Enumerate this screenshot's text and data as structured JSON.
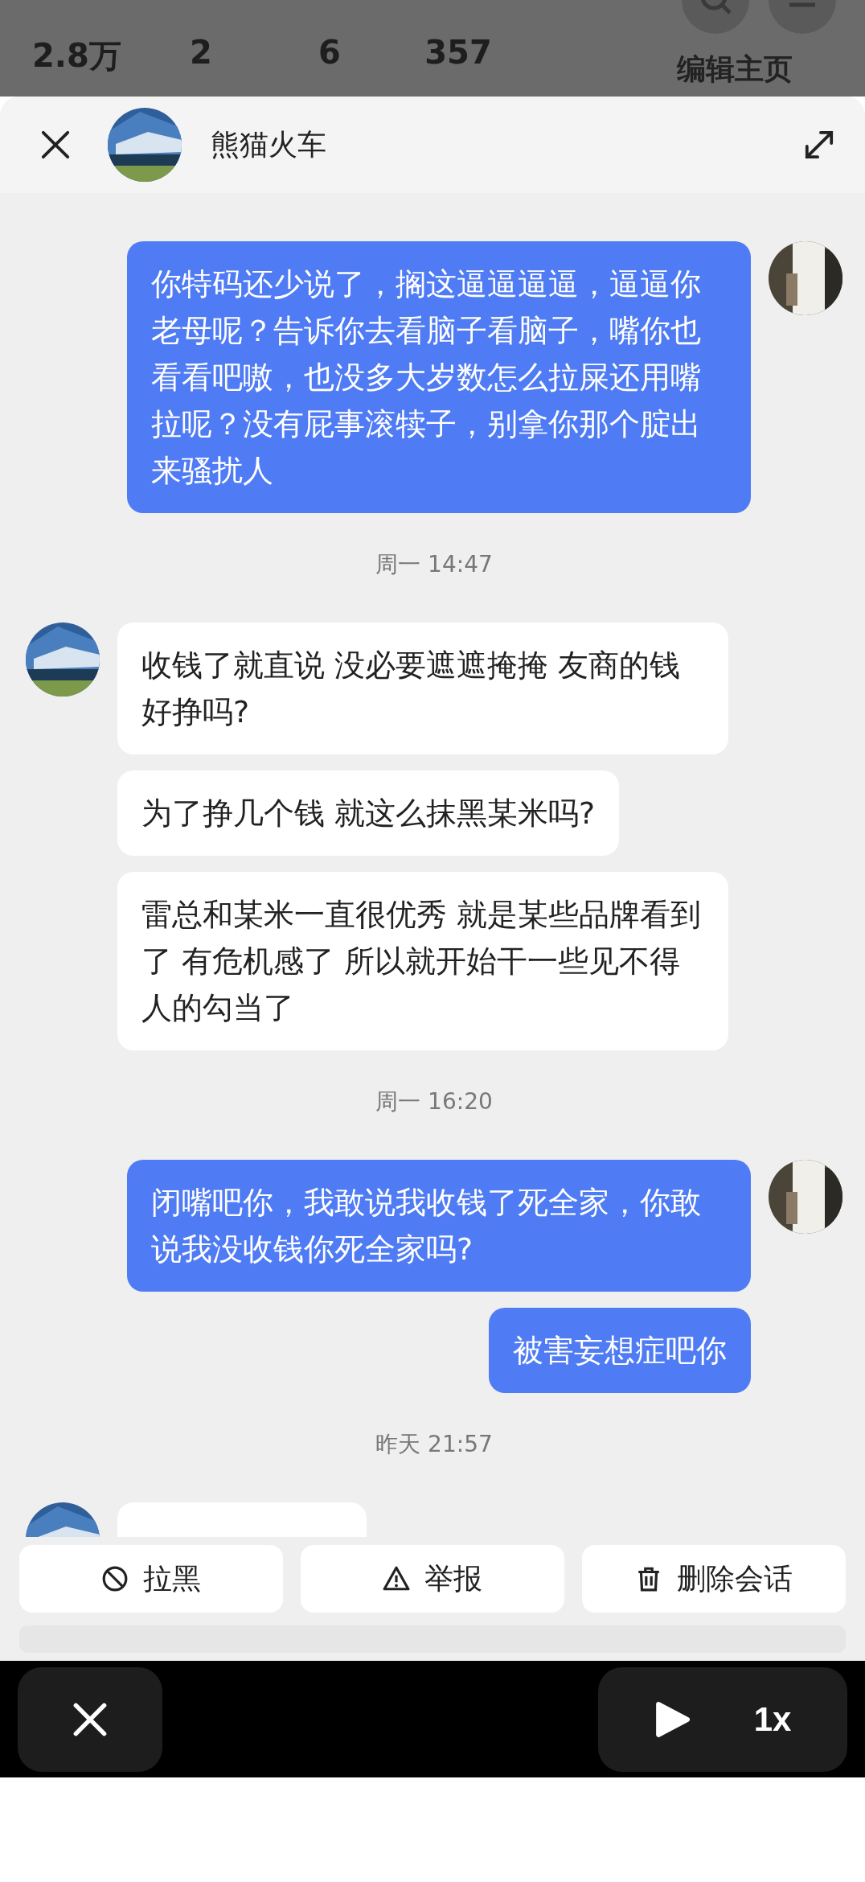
{
  "profile": {
    "stats": [
      {
        "value": "2.8万"
      },
      {
        "value": "2"
      },
      {
        "value": "6"
      },
      {
        "value": "357"
      }
    ],
    "edit_button": "编辑主页"
  },
  "chat": {
    "title": "熊猫火车"
  },
  "messages": [
    {
      "kind": "sent",
      "bubbles": [
        "你特码还少说了，搁这逼逼逼逼，逼逼你老母呢？告诉你去看脑子看脑子，嘴你也看看吧嗷，也没多大岁数怎么拉屎还用嘴拉呢？没有屁事滚犊子，别拿你那个腚出来骚扰人"
      ]
    },
    {
      "kind": "time",
      "text": "周一 14:47"
    },
    {
      "kind": "received",
      "bubbles": [
        "收钱了就直说 没必要遮遮掩掩 友商的钱好挣吗?",
        "为了挣几个钱 就这么抹黑某米吗?",
        "雷总和某米一直很优秀 就是某些品牌看到了 有危机感了 所以就开始干一些见不得人的勾当了"
      ]
    },
    {
      "kind": "time",
      "text": "周一 16:20"
    },
    {
      "kind": "sent",
      "bubbles": [
        "闭嘴吧你，我敢说我收钱了死全家，你敢说我没收钱你死全家吗?",
        "被害妄想症吧你"
      ]
    },
    {
      "kind": "time",
      "text": "昨天 21:57"
    },
    {
      "kind": "received-cut"
    }
  ],
  "actions": [
    {
      "kind": "block",
      "label": "拉黑"
    },
    {
      "kind": "report",
      "label": "举报"
    },
    {
      "kind": "delete",
      "label": "删除会话"
    }
  ],
  "player": {
    "speed": "1x"
  }
}
